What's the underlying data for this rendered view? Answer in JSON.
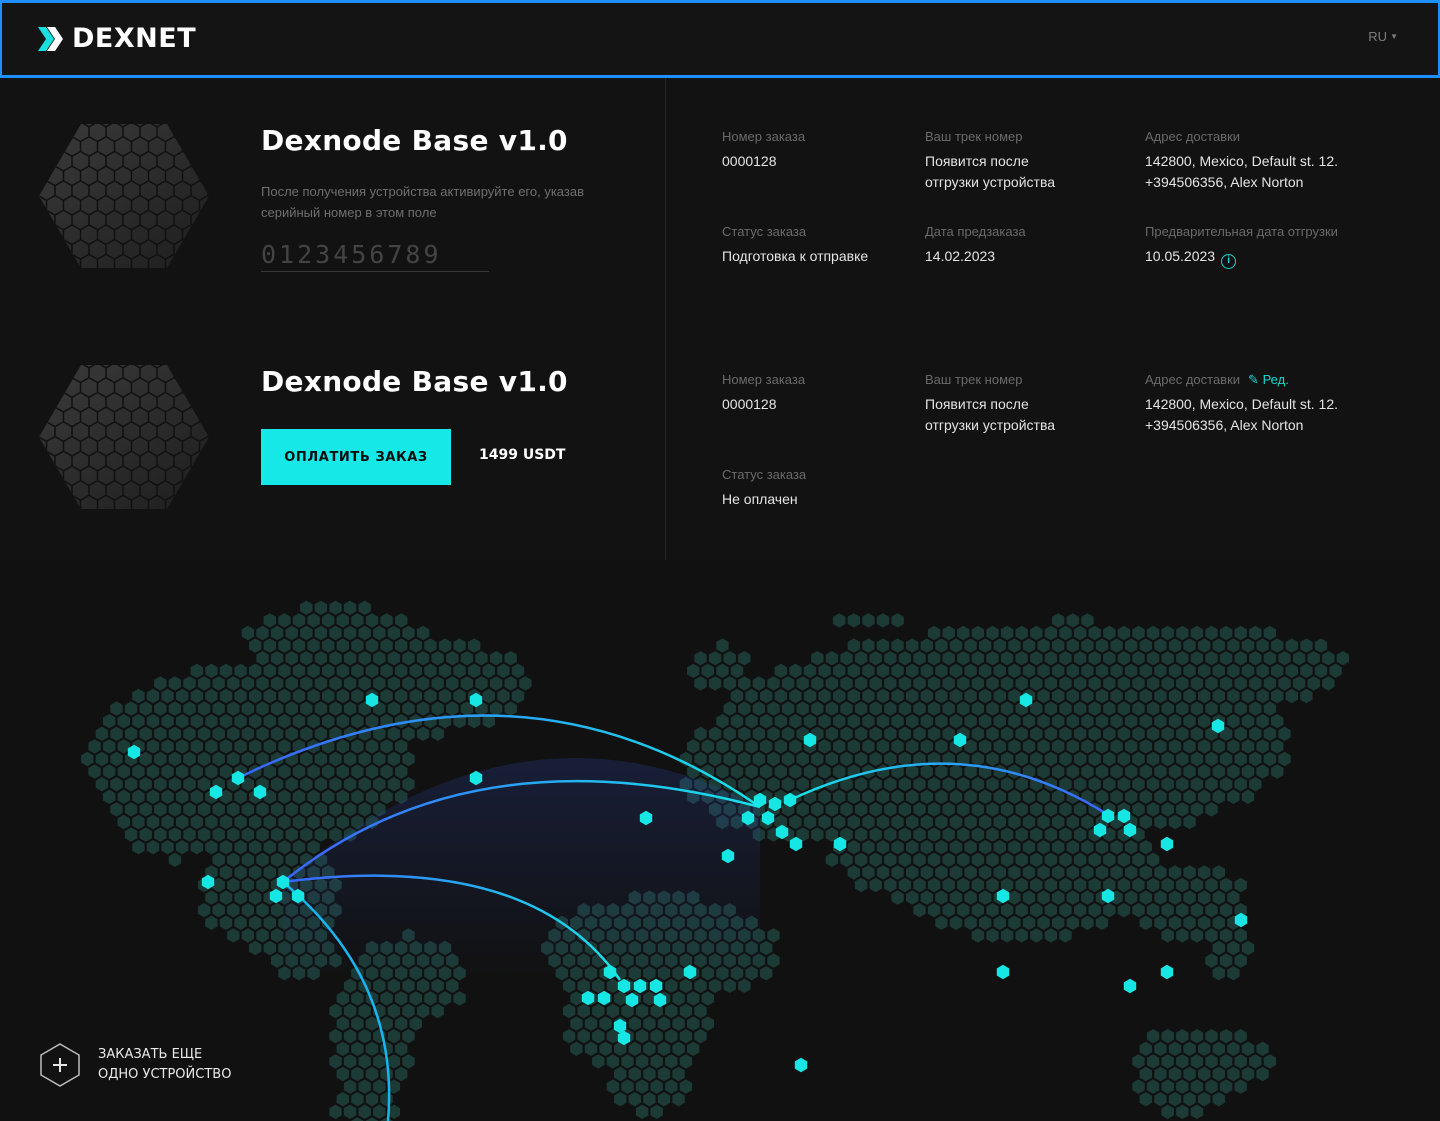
{
  "header": {
    "brand": "DEXNET",
    "language": "RU"
  },
  "orders": [
    {
      "title": "Dexnode Base v1.0",
      "description": "После получения устройства активируйте его, указав серийный номер в этом поле",
      "serial_placeholder": "0123456789",
      "order_number_label": "Номер заказа",
      "order_number": "0000128",
      "track_label": "Ваш трек номер",
      "track_value_line1": "Появится после",
      "track_value_line2": "отгрузки устройства",
      "address_label": "Адрес доставки",
      "address_line1": "142800, Mexico, Default st. 12.",
      "address_line2": "+394506356, Alex Norton",
      "status_label": "Статус заказа",
      "status_value": "Подготовка к отправке",
      "preorder_date_label": "Дата предзаказа",
      "preorder_date": "14.02.2023",
      "shipping_date_label": "Предварительная дата отгрузки",
      "shipping_date": "10.05.2023"
    },
    {
      "title": "Dexnode Base v1.0",
      "pay_button": "ОПЛАТИТЬ ЗАКАЗ",
      "price": "1499 USDT",
      "order_number_label": "Номер заказа",
      "order_number": "0000128",
      "track_label": "Ваш трек номер",
      "track_value_line1": "Появится после",
      "track_value_line2": "отгрузки устройства",
      "address_label": "Адрес доставки",
      "edit_label": "Ред.",
      "address_line1": "142800, Mexico, Default st. 12.",
      "address_line2": "+394506356, Alex Norton",
      "status_label": "Статус заказа",
      "status_value": "Не оплачен"
    }
  ],
  "order_more": {
    "line1": "ЗАКАЗАТЬ ЕЩЕ",
    "line2": "ОДНО УСТРОЙСТВО"
  },
  "colors": {
    "accent": "#15e8e6",
    "header_border": "#1e8fff",
    "map_land": "#1c3a36",
    "map_node": "#16e6e4"
  }
}
